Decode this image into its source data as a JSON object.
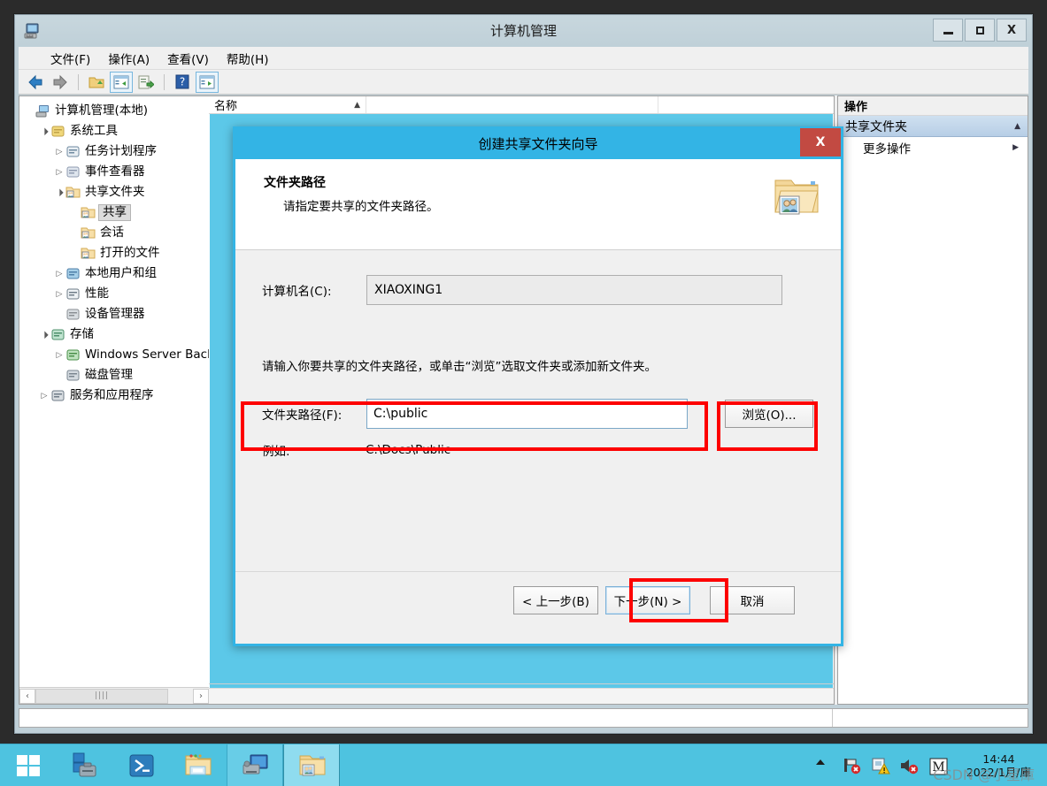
{
  "window": {
    "title": "计算机管理",
    "icon": "computer-management-icon",
    "buttons": {
      "minimize": "–",
      "maximize": "□",
      "close": "X"
    }
  },
  "menubar": [
    {
      "label": "文件(F)"
    },
    {
      "label": "操作(A)"
    },
    {
      "label": "查看(V)"
    },
    {
      "label": "帮助(H)"
    }
  ],
  "toolbar": [
    {
      "name": "back-icon"
    },
    {
      "name": "forward-icon"
    },
    {
      "name": "up-folder-icon"
    },
    {
      "name": "show-hide-console-tree-icon"
    },
    {
      "name": "export-list-icon"
    },
    {
      "name": "help-icon"
    },
    {
      "name": "show-action-pane-icon"
    }
  ],
  "tree": [
    {
      "label": "计算机管理(本地)",
      "indent": 0,
      "expander": "",
      "icon": "computer-icon",
      "selected": false
    },
    {
      "label": "系统工具",
      "indent": 1,
      "expander": "▲",
      "icon": "tools-icon",
      "selected": false
    },
    {
      "label": "任务计划程序",
      "indent": 2,
      "expander": "▶",
      "icon": "clock-icon",
      "selected": false
    },
    {
      "label": "事件查看器",
      "indent": 2,
      "expander": "▶",
      "icon": "event-viewer-icon",
      "selected": false
    },
    {
      "label": "共享文件夹",
      "indent": 2,
      "expander": "▲",
      "icon": "shared-folder-icon",
      "selected": false
    },
    {
      "label": "共享",
      "indent": 3,
      "expander": "",
      "icon": "shared-folder-icon",
      "selected": true
    },
    {
      "label": "会话",
      "indent": 3,
      "expander": "",
      "icon": "shared-folder-icon",
      "selected": false
    },
    {
      "label": "打开的文件",
      "indent": 3,
      "expander": "",
      "icon": "shared-folder-icon",
      "selected": false
    },
    {
      "label": "本地用户和组",
      "indent": 2,
      "expander": "▶",
      "icon": "users-icon",
      "selected": false
    },
    {
      "label": "性能",
      "indent": 2,
      "expander": "▶",
      "icon": "performance-icon",
      "selected": false
    },
    {
      "label": "设备管理器",
      "indent": 2,
      "expander": "",
      "icon": "device-manager-icon",
      "selected": false
    },
    {
      "label": "存储",
      "indent": 1,
      "expander": "▲",
      "icon": "storage-icon",
      "selected": false
    },
    {
      "label": "Windows Server Back",
      "indent": 2,
      "expander": "▶",
      "icon": "backup-icon",
      "selected": false
    },
    {
      "label": "磁盘管理",
      "indent": 2,
      "expander": "",
      "icon": "disk-management-icon",
      "selected": false
    },
    {
      "label": "服务和应用程序",
      "indent": 1,
      "expander": "▶",
      "icon": "services-icon",
      "selected": false
    }
  ],
  "list": {
    "columns": [
      {
        "label": "名称",
        "sort": "▲"
      },
      {
        "label": "",
        "sort": ""
      }
    ],
    "rows": []
  },
  "actions": {
    "title": "操作",
    "group": {
      "label": "共享文件夹",
      "caret": "▲"
    },
    "items": [
      {
        "label": "更多操作",
        "caret": "▶"
      }
    ]
  },
  "statusbar": {
    "left": "",
    "right": ""
  },
  "dialog": {
    "title": "创建共享文件夹向导",
    "close_label": "X",
    "header": {
      "heading": "文件夹路径",
      "subtext": "请指定要共享的文件夹路径。",
      "icon": "shared-folder-large-icon"
    },
    "computer_name": {
      "label": "计算机名(C):",
      "value": "XIAOXING1"
    },
    "instruction": "请输入你要共享的文件夹路径，或单击“浏览”选取文件夹或添加新文件夹。",
    "folder_path": {
      "label": "文件夹路径(F):",
      "value": "C:\\public",
      "placeholder": ""
    },
    "browse_button": "浏览(O)...",
    "example": {
      "label": "例如:",
      "value": "C:\\Docs\\Public"
    },
    "footer_buttons": {
      "back": "< 上一步(B)",
      "next": "下一步(N) >",
      "cancel": "取消"
    }
  },
  "taskbar": {
    "items": [
      {
        "name": "start-button-icon"
      },
      {
        "name": "server-manager-icon"
      },
      {
        "name": "powershell-icon"
      },
      {
        "name": "file-explorer-icon"
      },
      {
        "name": "computer-management-taskbar-icon"
      },
      {
        "name": "shared-folder-wizard-taskbar-icon"
      }
    ],
    "tray": [
      {
        "name": "show-hidden-icons-arrow"
      },
      {
        "name": "network-error-icon"
      },
      {
        "name": "flag-warning-icon"
      },
      {
        "name": "volume-muted-icon"
      },
      {
        "name": "m-app-icon"
      }
    ],
    "clock": {
      "time": "14:44",
      "date": "2022/1月/庫"
    }
  },
  "watermark": "CSDN @小星庫",
  "colors": {
    "accent": "#33b4e5",
    "taskbar": "#4ec3e0",
    "highlight_box": "#fd0000",
    "selection": "#5cc8e8",
    "titlebar": "#c8d7de"
  }
}
